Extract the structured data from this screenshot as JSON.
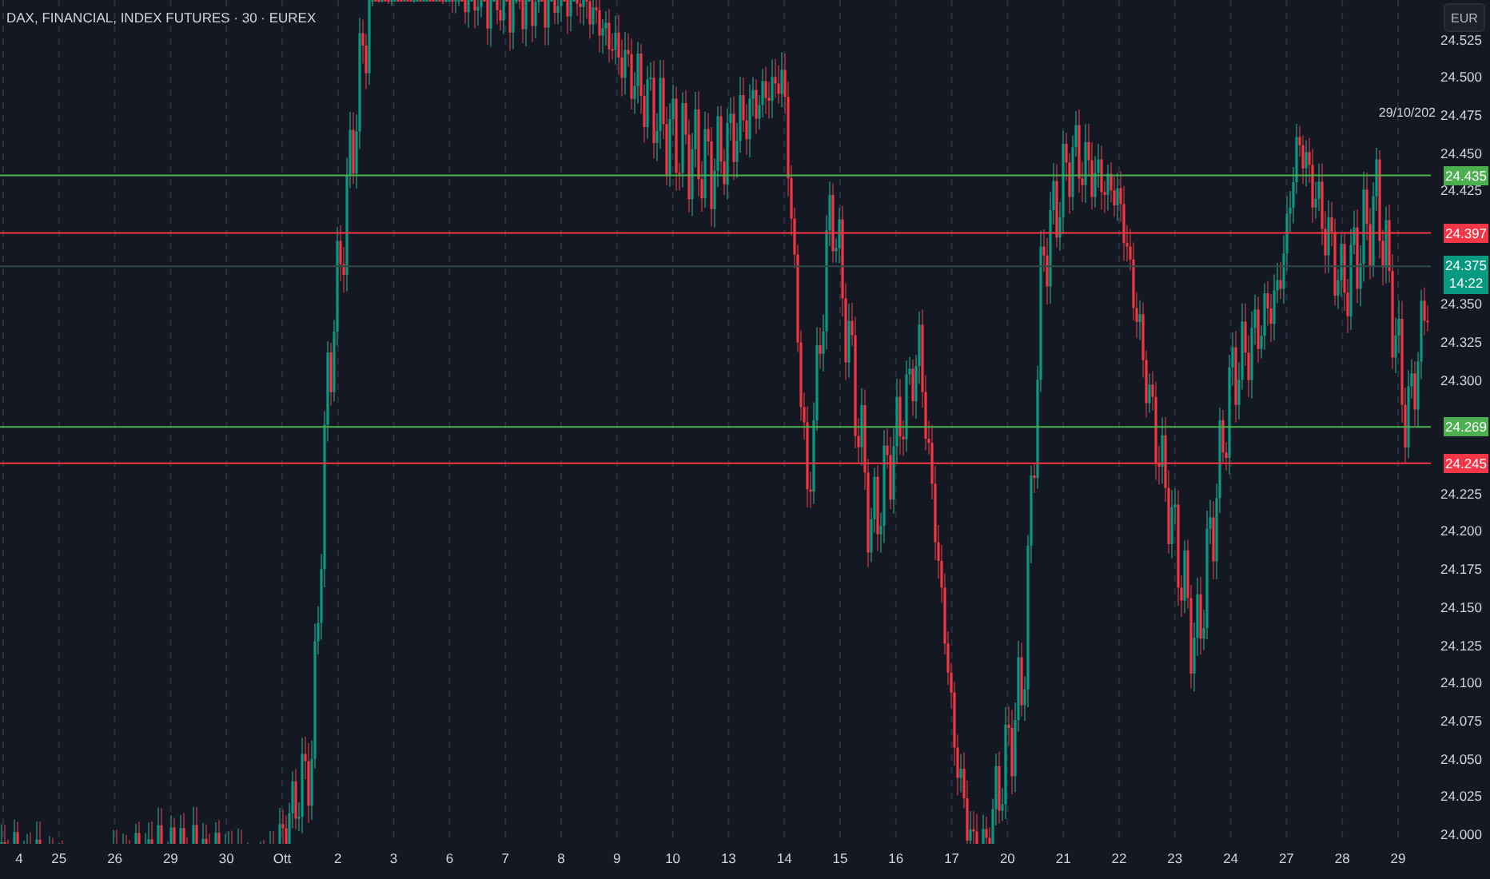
{
  "symbol_title": "DAX, FINANCIAL, INDEX FUTURES · 30 · EUREX",
  "currency_button": "EUR",
  "crosshair_date": "29/10/202",
  "price_axis": {
    "ticks": [
      "24.525",
      "24.500",
      "24.475",
      "24.450",
      "24.425",
      "24.350",
      "24.325",
      "24.300",
      "24.225",
      "24.200",
      "24.175",
      "24.150",
      "24.125",
      "24.100",
      "24.075",
      "24.050",
      "24.025",
      "24.000"
    ]
  },
  "levels": [
    {
      "price": "24.435",
      "color": "#4caf50"
    },
    {
      "price": "24.397",
      "color": "#f23645"
    },
    {
      "price": "24.269",
      "color": "#4caf50"
    },
    {
      "price": "24.245",
      "color": "#f23645"
    }
  ],
  "last_price": {
    "price": "24.375",
    "countdown": "14:22"
  },
  "time_axis": {
    "labels": [
      "4",
      "25",
      "26",
      "29",
      "30",
      "Ott",
      "2",
      "3",
      "6",
      "7",
      "8",
      "9",
      "10",
      "13",
      "14",
      "15",
      "16",
      "17",
      "20",
      "21",
      "22",
      "23",
      "24",
      "27",
      "28",
      "29"
    ]
  }
}
